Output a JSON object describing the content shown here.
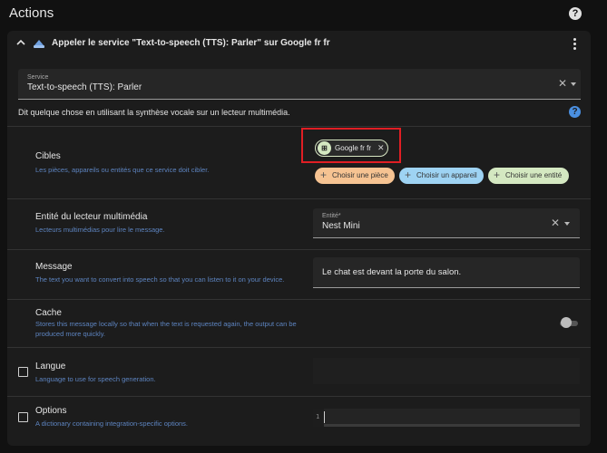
{
  "page": {
    "title": "Actions"
  },
  "card": {
    "title": "Appeler le service \"Text-to-speech (TTS): Parler\" sur Google fr fr",
    "service": {
      "caption": "Service",
      "value": "Text-to-speech (TTS): Parler"
    },
    "description": "Dit quelque chose en utilisant la synthèse vocale sur un lecteur multimédia."
  },
  "targets": {
    "title": "Cibles",
    "subtitle": "Les pièces, appareils ou entités que ce service doit cibler.",
    "chip_label": "Google fr fr",
    "buttons": {
      "area": "Choisir une pièce",
      "device": "Choisir un appareil",
      "entity": "Choisir une entité"
    }
  },
  "media_player": {
    "title": "Entité du lecteur multimédia",
    "subtitle": "Lecteurs multimédias pour lire le message.",
    "field_caption": "Entité*",
    "field_value": "Nest Mini"
  },
  "message": {
    "title": "Message",
    "subtitle": "The text you want to convert into speech so that you can listen to it on your device.",
    "value": "Le chat est devant la porte du salon."
  },
  "cache": {
    "title": "Cache",
    "subtitle": "Stores this message locally so that when the text is requested again, the output can be produced more quickly.",
    "enabled": false
  },
  "language": {
    "title": "Langue",
    "subtitle": "Language to use for speech generation.",
    "checked": false
  },
  "options": {
    "title": "Options",
    "subtitle": "A dictionary containing integration-specific options.",
    "checked": false,
    "line_number": "1"
  },
  "colors": {
    "background": "#111111",
    "card": "#1c1c1c",
    "field": "#262626",
    "accent_blue": "#4a8fe0",
    "subtitle_blue": "#5d84c0",
    "highlight_red": "#e01e24",
    "btn_area": "#f6c392",
    "btn_device": "#9ed3f3",
    "btn_entity": "#d4e8c1"
  }
}
